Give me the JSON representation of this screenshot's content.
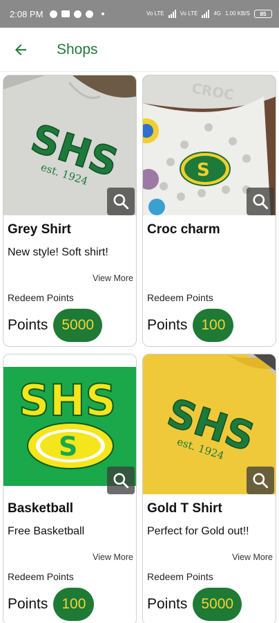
{
  "status_bar": {
    "time": "2:08 PM",
    "right_texts": [
      "Vo LTE",
      "Vo LTE",
      "4G",
      "1.00 KB/S"
    ],
    "battery": "85"
  },
  "app_bar": {
    "back_icon": "arrow-back-icon",
    "title": "Shops"
  },
  "colors": {
    "brand_green": "#1e7a34",
    "brand_gold": "#f2d43b",
    "title_green": "#1f7a36"
  },
  "products": [
    {
      "title": "Grey Shirt",
      "description": "New style! Soft shirt!",
      "view_more": "View More",
      "redeem_label": "Redeem Points",
      "points_label": "Points",
      "points": "5000",
      "image_text": [
        "SHS",
        "est. 1924"
      ]
    },
    {
      "title": "Croc charm",
      "description": "",
      "view_more": "",
      "redeem_label": "Redeem Points",
      "points_label": "Points",
      "points": "100",
      "image_text": [
        "CROC",
        "S"
      ]
    },
    {
      "title": "Basketball",
      "description": "Free Basketball",
      "view_more": "View More",
      "redeem_label": "Redeem Points",
      "points_label": "Points",
      "points": "100",
      "image_text": [
        "SHS",
        "S"
      ]
    },
    {
      "title": "Gold T Shirt",
      "description": "Perfect for Gold out!!",
      "view_more": "View More",
      "redeem_label": "Redeem Points",
      "points_label": "Points",
      "points": "5000",
      "image_text": [
        "SHS",
        "est. 1924"
      ]
    }
  ]
}
